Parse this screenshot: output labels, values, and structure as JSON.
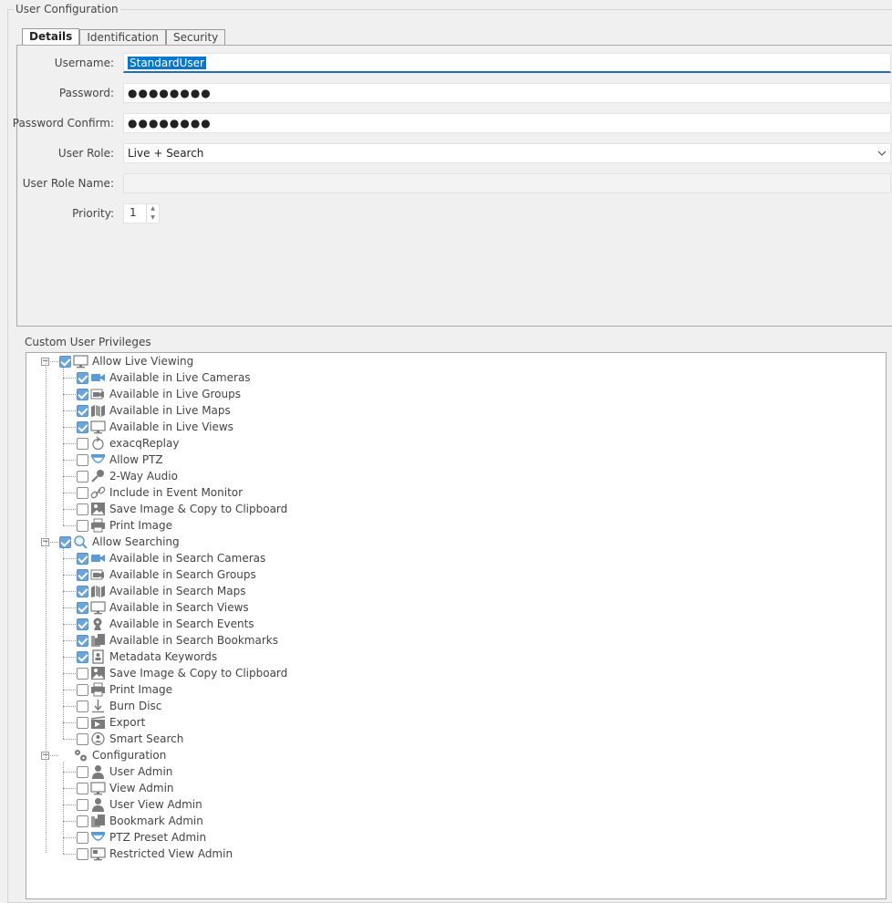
{
  "window": {
    "title": "User Configuration"
  },
  "tabs": [
    {
      "label": "Details",
      "active": true
    },
    {
      "label": "Identification",
      "active": false
    },
    {
      "label": "Security",
      "active": false
    }
  ],
  "details": {
    "username_label": "Username:",
    "username_value": "StandardUser",
    "password_label": "Password:",
    "password_value": "●●●●●●●●",
    "password_confirm_label": "Password Confirm:",
    "password_confirm_value": "●●●●●●●●",
    "user_role_label": "User Role:",
    "user_role_value": "Live + Search",
    "user_role_name_label": "User Role Name:",
    "user_role_name_value": "",
    "priority_label": "Priority:",
    "priority_value": "1"
  },
  "privileges": {
    "title": "Custom User Privileges",
    "groups": [
      {
        "label": "Allow Live Viewing",
        "icon": "monitor-icon",
        "checked": true,
        "has_checkbox": true,
        "items": [
          {
            "label": "Available in Live Cameras",
            "icon": "camera-icon",
            "checked": true
          },
          {
            "label": "Available in Live Groups",
            "icon": "camera-group-icon",
            "checked": true
          },
          {
            "label": "Available in Live Maps",
            "icon": "map-icon",
            "checked": true
          },
          {
            "label": "Available in Live Views",
            "icon": "monitor-icon",
            "checked": true
          },
          {
            "label": "exacqReplay",
            "icon": "replay-icon",
            "checked": false
          },
          {
            "label": "Allow PTZ",
            "icon": "ptz-dome-icon",
            "checked": false
          },
          {
            "label": "2-Way Audio",
            "icon": "microphone-icon",
            "checked": false
          },
          {
            "label": "Include in Event Monitor",
            "icon": "link-icon",
            "checked": false
          },
          {
            "label": "Save Image & Copy to Clipboard",
            "icon": "image-icon",
            "checked": false
          },
          {
            "label": "Print Image",
            "icon": "printer-icon",
            "checked": false
          }
        ]
      },
      {
        "label": "Allow Searching",
        "icon": "search-icon",
        "checked": true,
        "has_checkbox": true,
        "items": [
          {
            "label": "Available in Search Cameras",
            "icon": "camera-icon",
            "checked": true
          },
          {
            "label": "Available in Search Groups",
            "icon": "camera-group-icon",
            "checked": true
          },
          {
            "label": "Available in Search Maps",
            "icon": "map-icon",
            "checked": true
          },
          {
            "label": "Available in Search Views",
            "icon": "monitor-icon",
            "checked": true
          },
          {
            "label": "Available in Search Events",
            "icon": "event-icon",
            "checked": true
          },
          {
            "label": "Available in Search Bookmarks",
            "icon": "bookmark-icon",
            "checked": true
          },
          {
            "label": "Metadata Keywords",
            "icon": "keyword-icon",
            "checked": true
          },
          {
            "label": "Save Image & Copy to Clipboard",
            "icon": "image-icon",
            "checked": false
          },
          {
            "label": "Print Image",
            "icon": "printer-icon",
            "checked": false
          },
          {
            "label": "Burn Disc",
            "icon": "burn-disc-icon",
            "checked": false
          },
          {
            "label": "Export",
            "icon": "export-icon",
            "checked": false
          },
          {
            "label": "Smart Search",
            "icon": "smart-search-icon",
            "checked": false
          }
        ]
      },
      {
        "label": "Configuration",
        "icon": "gears-icon",
        "checked": false,
        "has_checkbox": false,
        "items": [
          {
            "label": "User Admin",
            "icon": "user-icon",
            "checked": false
          },
          {
            "label": "View Admin",
            "icon": "monitor-icon",
            "checked": false
          },
          {
            "label": "User View Admin",
            "icon": "user-icon",
            "checked": false
          },
          {
            "label": "Bookmark Admin",
            "icon": "bookmark-icon",
            "checked": false
          },
          {
            "label": "PTZ Preset Admin",
            "icon": "ptz-dome-icon",
            "checked": false
          },
          {
            "label": "Restricted View Admin",
            "icon": "restricted-view-icon",
            "checked": false
          }
        ]
      }
    ]
  },
  "colors": {
    "accent": "#0078d7",
    "check_fill": "#6aa5e0",
    "icon_blue": "#5b9bd5",
    "icon_gray": "#7a7a7a"
  }
}
